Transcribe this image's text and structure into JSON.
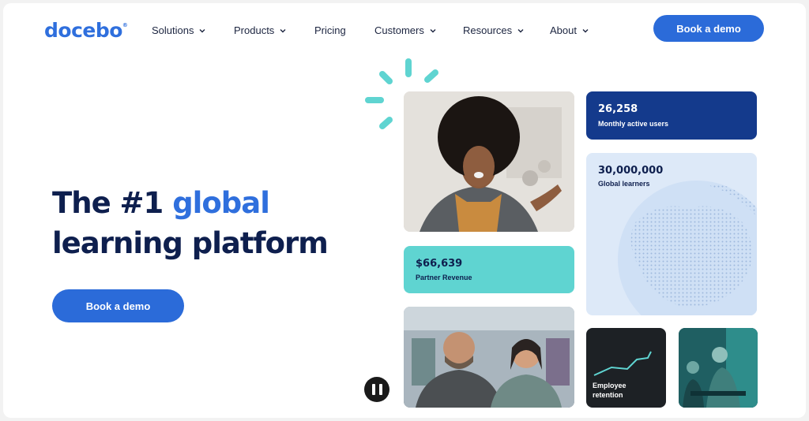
{
  "header": {
    "logo": "docebo",
    "logo_mark": "®",
    "nav": [
      {
        "label": "Solutions",
        "has_dropdown": true
      },
      {
        "label": "Products",
        "has_dropdown": true
      },
      {
        "label": "Pricing",
        "has_dropdown": false
      },
      {
        "label": "Customers",
        "has_dropdown": true
      },
      {
        "label": "Resources",
        "has_dropdown": true
      },
      {
        "label": "About",
        "has_dropdown": true
      }
    ],
    "cta_label": "Book a demo"
  },
  "hero": {
    "title_part1": "The #1 ",
    "title_accent": "global",
    "title_part2": "learning platform",
    "cta_label": "Book a demo"
  },
  "stats": {
    "users": {
      "value": "26,258",
      "label": "Monthly active users"
    },
    "learners": {
      "value": "30,000,000",
      "label": "Global learners"
    },
    "revenue": {
      "value": "$66,639",
      "label": "Partner Revenue"
    },
    "retention": {
      "label_line1": "Employee",
      "label_line2": "retention"
    }
  },
  "colors": {
    "brand_blue": "#2b6bd9",
    "navy": "#0e1f4e",
    "dark_blue_card": "#143a8c",
    "teal": "#5fd4d1",
    "light_blue_card": "#dde9f8"
  },
  "icons": {
    "pause": "pause-icon",
    "chevron": "chevron-down-icon"
  }
}
